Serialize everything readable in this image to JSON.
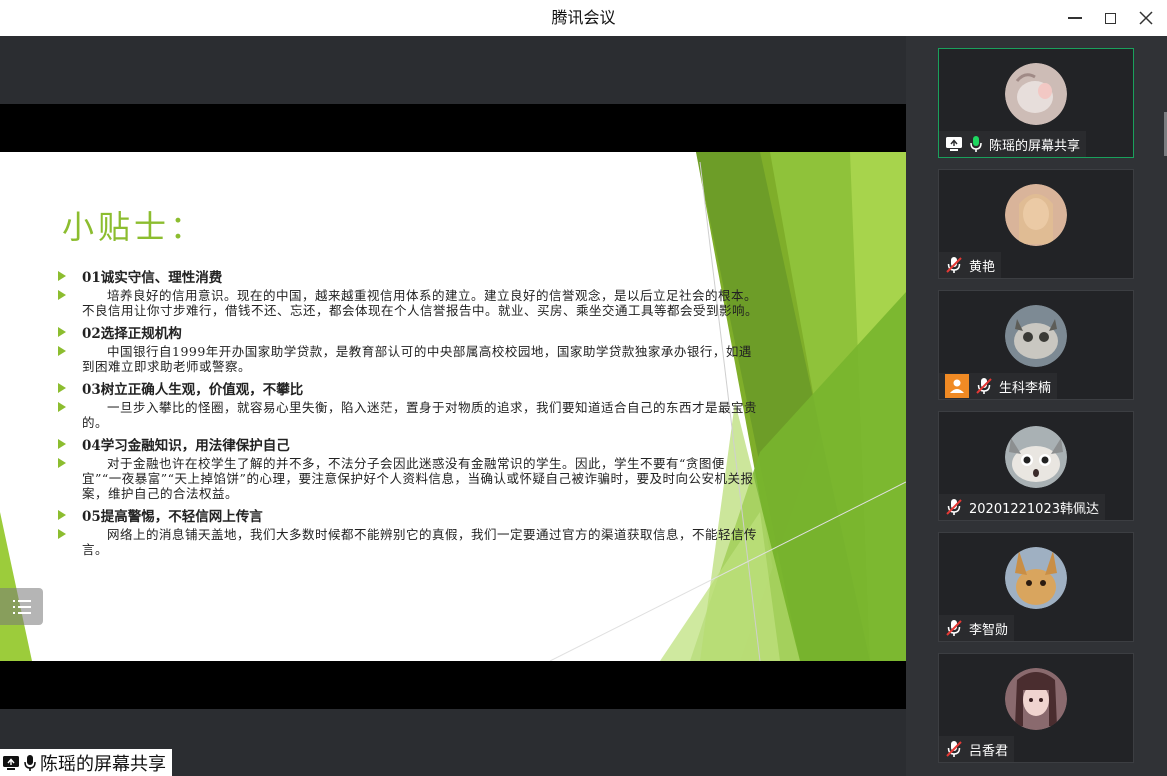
{
  "window": {
    "title": "腾讯会议"
  },
  "slide": {
    "title": "小贴士：",
    "tips": [
      {
        "heading": "01诚实守信、理性消费",
        "body": "培养良好的信用意识。现在的中国，越来越重视信用体系的建立。建立良好的信誉观念，是以后立足社会的根本。不良信用让你寸步难行，借钱不还、忘还，都会体现在个人信誉报告中。就业、买房、乘坐交通工具等都会受到影响。"
      },
      {
        "heading": "02选择正规机构",
        "body": "中国银行自1999年开办国家助学贷款，是教育部认可的中央部属高校校园地，国家助学贷款独家承办银行，如遇到困难立即求助老师或警察。"
      },
      {
        "heading": "03树立正确人生观，价值观，不攀比",
        "body": "一旦步入攀比的怪圈，就容易心里失衡，陷入迷茫，置身于对物质的追求，我们要知道适合自己的东西才是最宝贵的。"
      },
      {
        "heading": "04学习金融知识，用法律保护自己",
        "body": "对于金融也许在校学生了解的并不多，不法分子会因此迷惑没有金融常识的学生。因此，学生不要有“贪图便宜”“一夜暴富”“天上掉馅饼”的心理，要注意保护好个人资料信息，当确认或怀疑自己被诈骗时，要及时向公安机关报案，维护自己的合法权益。"
      },
      {
        "heading": "05提高警惕，不轻信网上传言",
        "body": "网络上的消息铺天盖地，我们大多数时候都不能辨别它的真假，我们一定要通过官方的渠道获取信息，不能轻信传言。"
      }
    ]
  },
  "share_label": "陈瑶的屏幕共享",
  "participants": [
    {
      "name": "陈瑶的屏幕共享",
      "active": true,
      "muted": false,
      "sharing": true,
      "host": false,
      "avatar_color": "#c9b7b0"
    },
    {
      "name": "黄艳",
      "active": false,
      "muted": true,
      "sharing": false,
      "host": false,
      "avatar_color": "#d9b49a"
    },
    {
      "name": "生科李楠",
      "active": false,
      "muted": true,
      "sharing": false,
      "host": true,
      "avatar_color": "#7d8a94"
    },
    {
      "name": "20201221023韩佩达",
      "active": false,
      "muted": true,
      "sharing": false,
      "host": false,
      "avatar_color": "#a9b1b4"
    },
    {
      "name": "李智勋",
      "active": false,
      "muted": true,
      "sharing": false,
      "host": false,
      "avatar_color": "#c9a26a"
    },
    {
      "name": "吕香君",
      "active": false,
      "muted": true,
      "sharing": false,
      "host": false,
      "avatar_color": "#8a6a6e"
    }
  ],
  "colors": {
    "accent_green": "#8cbd2f",
    "active_border": "#1aa05c",
    "host_orange": "#f08a24"
  }
}
